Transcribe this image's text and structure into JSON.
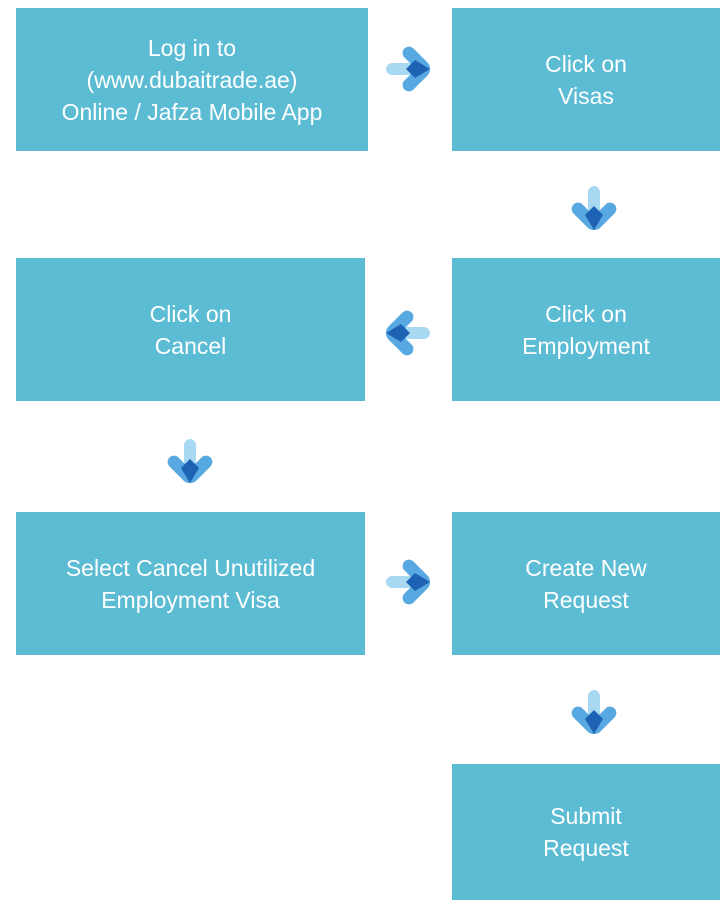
{
  "colors": {
    "box_fill": "#5bbcd4",
    "box_text": "#ffffff",
    "arrow_light": "#a9d8f2",
    "arrow_mid": "#58a8e2",
    "arrow_dark": "#1e62b4"
  },
  "steps": [
    {
      "label": "Log in to\n(www.dubaitrade.ae)\nOnline / Jafza Mobile App"
    },
    {
      "label": "Click on\nVisas"
    },
    {
      "label": "Click on\nEmployment"
    },
    {
      "label": "Click on\nCancel"
    },
    {
      "label": "Select Cancel Unutilized\nEmployment Visa"
    },
    {
      "label": "Create New\nRequest"
    },
    {
      "label": "Submit\nRequest"
    }
  ],
  "arrows": [
    {
      "from": "step-1",
      "to": "step-2",
      "direction": "right",
      "icon": "arrow-right-icon"
    },
    {
      "from": "step-2",
      "to": "step-3",
      "direction": "down",
      "icon": "arrow-down-icon"
    },
    {
      "from": "step-3",
      "to": "step-4",
      "direction": "left",
      "icon": "arrow-left-icon"
    },
    {
      "from": "step-4",
      "to": "step-5",
      "direction": "down",
      "icon": "arrow-down-icon"
    },
    {
      "from": "step-5",
      "to": "step-6",
      "direction": "right",
      "icon": "arrow-right-icon"
    },
    {
      "from": "step-6",
      "to": "step-7",
      "direction": "down",
      "icon": "arrow-down-icon"
    }
  ]
}
